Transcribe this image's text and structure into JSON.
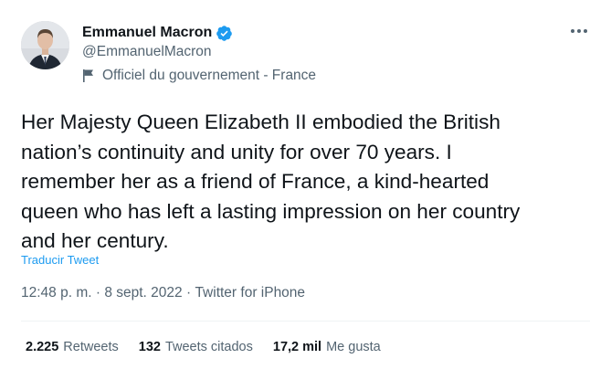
{
  "author": {
    "display_name": "Emmanuel Macron",
    "handle": "@EmmanuelMacron",
    "label": "Officiel du gouvernement - France",
    "verified": true
  },
  "tweet": {
    "text": "Her Majesty Queen Elizabeth II embodied the British\nnation’s continuity and unity for over 70 years. I\nremember her as a friend of France, a kind-hearted\nqueen who has left a lasting impression on her country\nand her century.",
    "translate_label": "Traducir Tweet",
    "time": "12:48 p. m.",
    "separator": " · ",
    "date": "8 sept. 2022",
    "source": "Twitter for iPhone"
  },
  "stats": {
    "retweets_count": "2.225",
    "retweets_label": "Retweets",
    "quotes_count": "132",
    "quotes_label": "Tweets citados",
    "likes_count": "17,2 mil",
    "likes_label": "Me gusta"
  },
  "colors": {
    "link": "#1d9bf0",
    "secondary_text": "#536471",
    "primary_text": "#0f1419",
    "verified_badge": "#1d9bf0"
  },
  "icons": {
    "verified": "verified-badge-icon",
    "government_label": "flag-icon",
    "more": "more-options-icon"
  }
}
